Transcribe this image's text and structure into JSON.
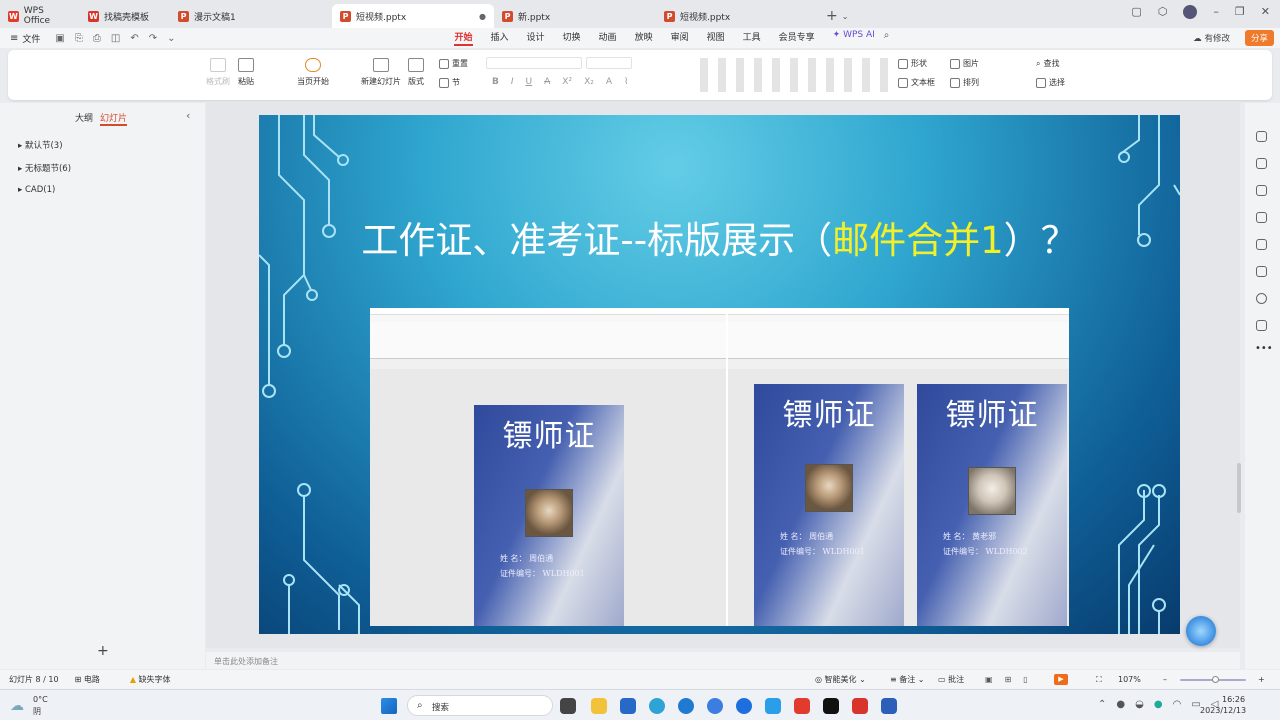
{
  "tabs": [
    {
      "label": "WPS Office",
      "color": "#e23b2e",
      "letter": "W"
    },
    {
      "label": "找稿壳模板",
      "color": "#d9342b",
      "letter": "W"
    },
    {
      "label": "漫示文稿1",
      "color": "#d24b2c",
      "letter": "P"
    },
    {
      "label": "短视频.pptx",
      "color": "#d24b2c",
      "letter": "P",
      "active": true
    },
    {
      "label": "新.pptx",
      "color": "#d24b2c",
      "letter": "P"
    },
    {
      "label": "短视频.pptx",
      "color": "#d24b2c",
      "letter": "P"
    }
  ],
  "menu": {
    "file": "文件",
    "items": [
      "开始",
      "插入",
      "设计",
      "切换",
      "动画",
      "放映",
      "审阅",
      "视图",
      "工具",
      "会员专享"
    ],
    "ai": "WPS AI",
    "modify": "有修改",
    "share": "分享"
  },
  "ribbon": {
    "format_painter": "格式刷",
    "paste": "粘贴",
    "start_from_current": "当页开始",
    "new_slide": "新建幻灯片",
    "layout": "版式",
    "reset": "重置",
    "section": "节",
    "shape": "形状",
    "picture": "图片",
    "textbox": "文本框",
    "arrange": "排列",
    "find": "查找",
    "select": "选择"
  },
  "sidepanel": {
    "outline": "大纲",
    "slides": "幻灯片",
    "sections": [
      "默认节(3)",
      "无标题节(6)",
      "CAD(1)"
    ],
    "add": "+"
  },
  "slide": {
    "title_a": "工作证、准考证--标版展示（",
    "title_hl": "邮件合并1",
    "title_b": "）？",
    "cards": [
      {
        "title": "镖师证",
        "name_line": "姓    名：  周伯通",
        "id_line": "证件编号：  WLDH001"
      },
      {
        "title": "镖师证",
        "name_line": "姓    名：  周伯通",
        "id_line": "证件编号：  WLDH001"
      },
      {
        "title": "镖师证",
        "name_line": "姓    名：  黄老邪",
        "id_line": "证件编号：  WLDH002"
      }
    ]
  },
  "notes": "单击此处添加备注",
  "status": {
    "slide": "幻灯片 8 / 10",
    "theme": "电路",
    "font": "缺失字体",
    "beautify": "智能美化",
    "notes_btn": "备注",
    "comment": "批注",
    "zoom": "107%"
  },
  "taskbar": {
    "weather_temp": "0°C",
    "weather_desc": "阴",
    "search": "搜索",
    "time": "16:26",
    "date": "2023/12/13"
  }
}
